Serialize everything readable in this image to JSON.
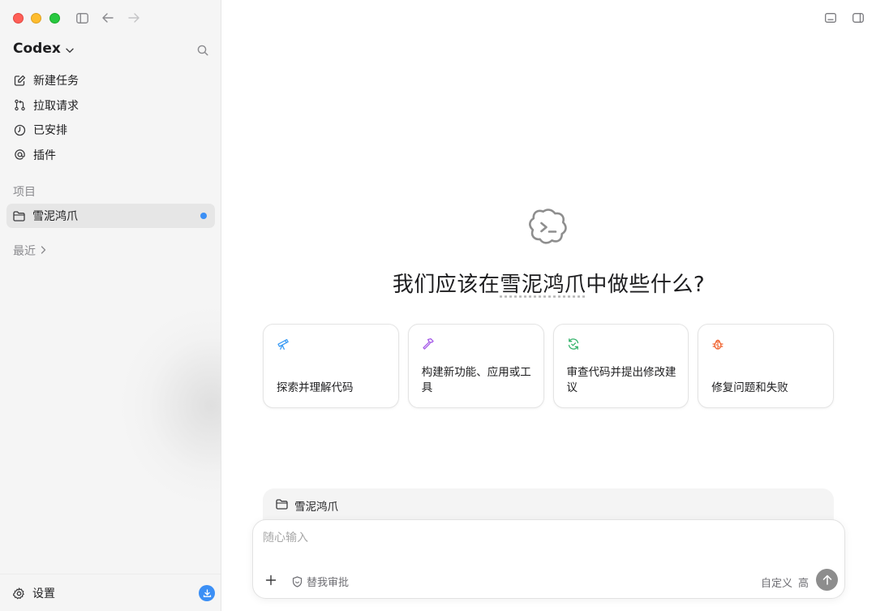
{
  "sidebar": {
    "app_name": "Codex",
    "nav": [
      {
        "label": "新建任务",
        "icon": "edit-icon"
      },
      {
        "label": "拉取请求",
        "icon": "pull-request-icon"
      },
      {
        "label": "已安排",
        "icon": "clock-icon"
      },
      {
        "label": "插件",
        "icon": "at-icon"
      }
    ],
    "projects_label": "项目",
    "project": {
      "name": "雪泥鸿爪",
      "icon": "folder-icon",
      "indicator_color": "#3b8ff5"
    },
    "recent_label": "最近",
    "settings_label": "设置"
  },
  "main": {
    "heading_prefix": "我们应该在",
    "heading_project": "雪泥鸿爪",
    "heading_suffix": "中做些什么?",
    "cards": [
      {
        "label": "探索并理解代码",
        "icon": "telescope-icon",
        "color": "#3b9cf5"
      },
      {
        "label": "构建新功能、应用或工具",
        "icon": "hammer-icon",
        "color": "#a65ce8"
      },
      {
        "label": "审查代码并提出修改建议",
        "icon": "review-cycle-icon",
        "color": "#34b36b"
      },
      {
        "label": "修复问题和失败",
        "icon": "bug-icon",
        "color": "#f0622d"
      }
    ],
    "context_project": "雪泥鸿爪",
    "composer": {
      "placeholder": "随心输入",
      "approve_label": "替我审批",
      "mode_label": "自定义",
      "level_label": "高"
    }
  },
  "colors": {
    "sidebar_bg": "#f5f5f5",
    "accent_blue": "#3b8ff5",
    "send_button": "#8d8d8d"
  }
}
